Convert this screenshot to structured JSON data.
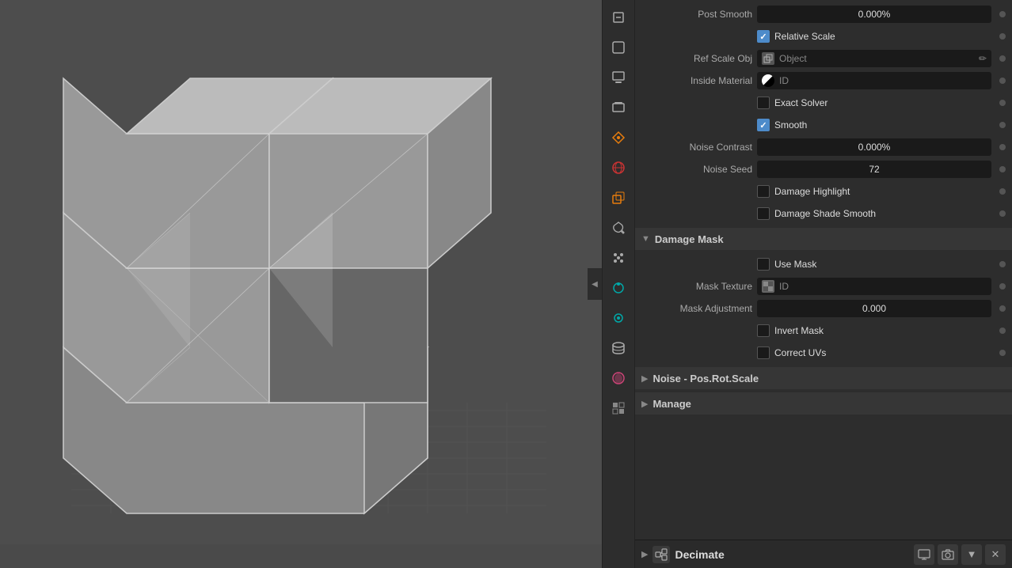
{
  "viewport": {
    "toggle_arrow": "◀"
  },
  "sidebar": {
    "icons": [
      {
        "id": "tools-icon",
        "symbol": "🔧",
        "class": ""
      },
      {
        "id": "object-data-icon",
        "symbol": "◻",
        "class": ""
      },
      {
        "id": "output-icon",
        "symbol": "🖨",
        "class": ""
      },
      {
        "id": "view-layer-icon",
        "symbol": "🖼",
        "class": ""
      },
      {
        "id": "scene-icon",
        "symbol": "💧",
        "class": "orange"
      },
      {
        "id": "world-icon",
        "symbol": "🌐",
        "class": "red"
      },
      {
        "id": "object-icon",
        "symbol": "◻",
        "class": "orange"
      },
      {
        "id": "modifier-icon",
        "symbol": "🔧",
        "class": ""
      },
      {
        "id": "particles-icon",
        "symbol": "⚙",
        "class": ""
      },
      {
        "id": "physics-icon",
        "symbol": "🔵",
        "class": ""
      },
      {
        "id": "constraints-icon",
        "symbol": "⊙",
        "class": "teal"
      },
      {
        "id": "data-icon",
        "symbol": "▼",
        "class": ""
      },
      {
        "id": "material-icon",
        "symbol": "⬤",
        "class": "pink"
      },
      {
        "id": "checker-icon",
        "symbol": "⊞",
        "class": "checker"
      }
    ]
  },
  "properties": {
    "rows": [
      {
        "type": "value",
        "label": "Post Smooth",
        "value": "0.000%",
        "centered": true
      }
    ],
    "relative_scale": {
      "label": "Relative Scale",
      "checked": true
    },
    "ref_scale_obj": {
      "label": "Ref Scale Obj",
      "placeholder": "Object"
    },
    "inside_material": {
      "label": "Inside Material",
      "value": "ID"
    },
    "exact_solver": {
      "label": "Exact Solver",
      "checked": false
    },
    "smooth": {
      "label": "Smooth",
      "checked": true
    },
    "noise_contrast": {
      "label": "Noise Contrast",
      "value": "0.000%",
      "centered": true
    },
    "noise_seed": {
      "label": "Noise Seed",
      "value": "72",
      "centered": true
    },
    "damage_highlight": {
      "label": "Damage Highlight",
      "checked": false
    },
    "damage_shade_smooth": {
      "label": "Damage Shade Smooth",
      "checked": false
    },
    "damage_mask_section": {
      "title": "Damage Mask"
    },
    "use_mask": {
      "label": "Use Mask",
      "checked": false
    },
    "mask_texture": {
      "label": "Mask Texture",
      "value": "ID"
    },
    "mask_adjustment": {
      "label": "Mask Adjustment",
      "value": "0.000",
      "centered": true
    },
    "invert_mask": {
      "label": "Invert Mask",
      "checked": false
    },
    "correct_uvs": {
      "label": "Correct UVs",
      "checked": false
    },
    "noise_pos_rot_scale": {
      "title": "Noise - Pos.Rot.Scale"
    },
    "manage": {
      "title": "Manage"
    }
  },
  "bottom_bar": {
    "title": "Decimate",
    "actions": [
      "🖥",
      "📷",
      "▼",
      "✕"
    ]
  }
}
